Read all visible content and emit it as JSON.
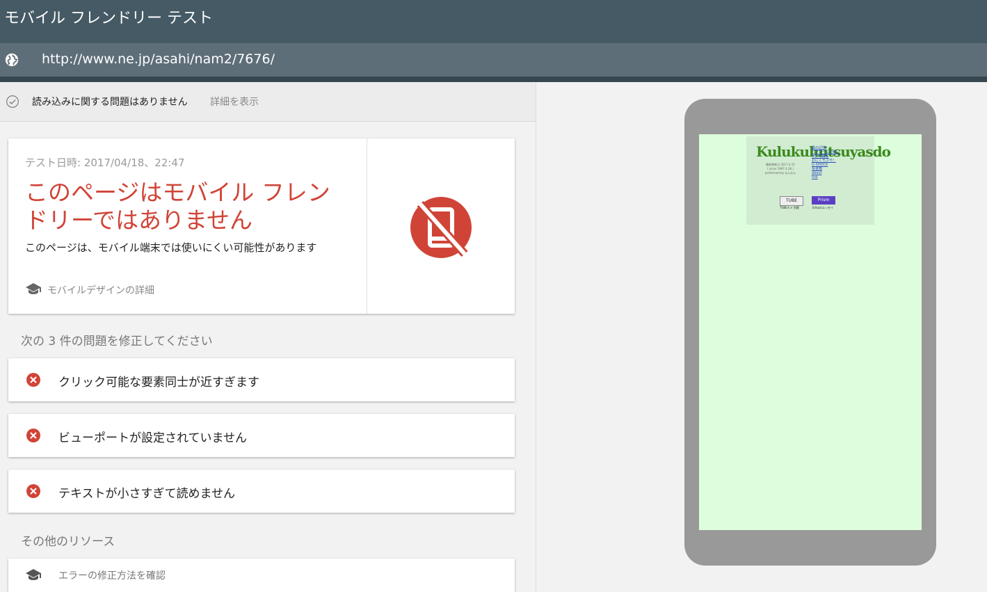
{
  "app": {
    "title": "モバイル フレンドリー テスト"
  },
  "urlbar": {
    "url": "http://www.ne.jp/asahi/nam2/7676/",
    "icon": "globe-icon"
  },
  "status": {
    "label": "読み込みに関する問題はありません",
    "details_link": "詳細を表示",
    "icon": "check-circle-icon"
  },
  "result": {
    "date": "テスト日時: 2017/04/18、22:47",
    "heading": "このページはモバイル フレンドリーではありません",
    "sub": "このページは、モバイル端末では使いにくい可能性があります",
    "learn_link": "モバイルデザインの詳細",
    "status_icon": "not-mobile-friendly-icon",
    "accent_color": "#d04437"
  },
  "issues": {
    "title": "次の 3 件の問題を修正してください",
    "items": [
      {
        "label": "クリック可能な要素同士が近すぎます"
      },
      {
        "label": "ビューポートが設定されていません"
      },
      {
        "label": "テキストが小さすぎて読めません"
      }
    ]
  },
  "resources": {
    "title": "その他のリソース",
    "items": [
      {
        "label": "エラーの修正方法を確認"
      }
    ]
  },
  "preview": {
    "site_logo": "Kulukuluitsuyasdo",
    "site_logo_tail": "do",
    "site_meta": [
      "最終更新日 2017.4.15",
      "( since 1997.4.28 )",
      "performed by なんなん"
    ],
    "site_links": [
      "風の記憶",
      "（フレーム仕様）",
      "my 知識帳",
      "おにくモスモ！",
      "G-SHOCK",
      "投書箱",
      "about",
      "link"
    ],
    "banners": [
      {
        "label": "TUBE",
        "caption": "TUBEホメ 別館"
      },
      {
        "label": "Prism",
        "caption": "Erikaのエッセイ"
      }
    ]
  },
  "colors": {
    "appbar": "#455a64",
    "urlbar": "#5e6e78",
    "screen_bg": "#dcfedc"
  }
}
